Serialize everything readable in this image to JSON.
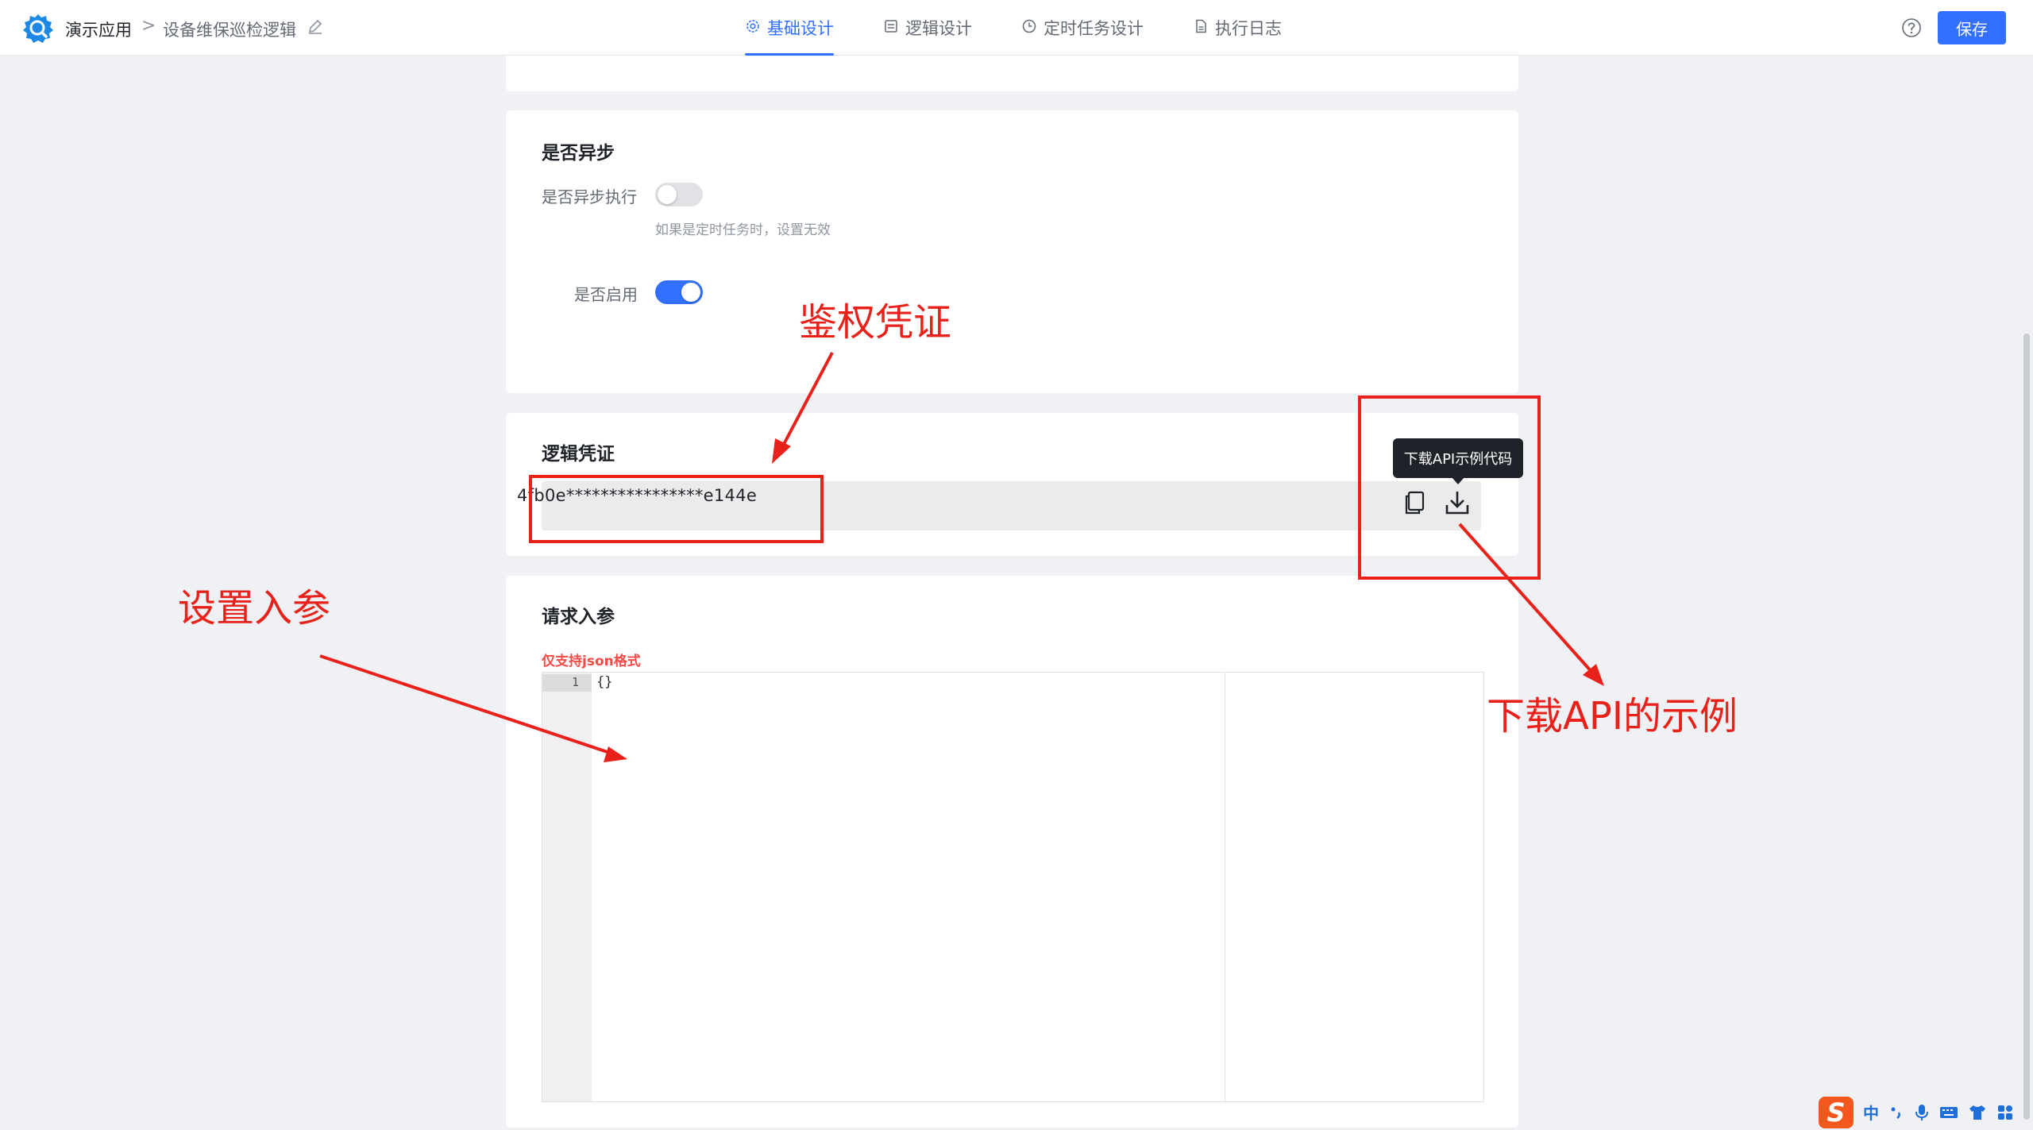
{
  "header": {
    "app_name": "演示应用",
    "breadcrumb_separator": ">",
    "page_name": "设备维保巡检逻辑",
    "tabs": [
      {
        "label": "基础设计",
        "active": true
      },
      {
        "label": "逻辑设计",
        "active": false
      },
      {
        "label": "定时任务设计",
        "active": false
      },
      {
        "label": "执行日志",
        "active": false
      }
    ],
    "save_label": "保存"
  },
  "async_section": {
    "title": "是否异步",
    "async_label": "是否异步执行",
    "async_enabled": false,
    "async_hint": "如果是定时任务时，设置无效",
    "enable_label": "是否启用",
    "enabled": true
  },
  "credential_section": {
    "title": "逻辑凭证",
    "value": "4fb0e****************e144e",
    "download_tooltip": "下载API示例代码"
  },
  "params_section": {
    "title": "请求入参",
    "json_hint": "仅支持json格式",
    "line_numbers": [
      "1"
    ],
    "code": "{}"
  },
  "annotations": {
    "credential_note": "鉴权凭证",
    "params_note": "设置入参",
    "download_note": "下载API的示例"
  },
  "ime": {
    "logo": "S",
    "lang": "中"
  },
  "colors": {
    "accent": "#3370ff",
    "annotation_red": "#e8221a",
    "hint_red": "#f54a45"
  }
}
